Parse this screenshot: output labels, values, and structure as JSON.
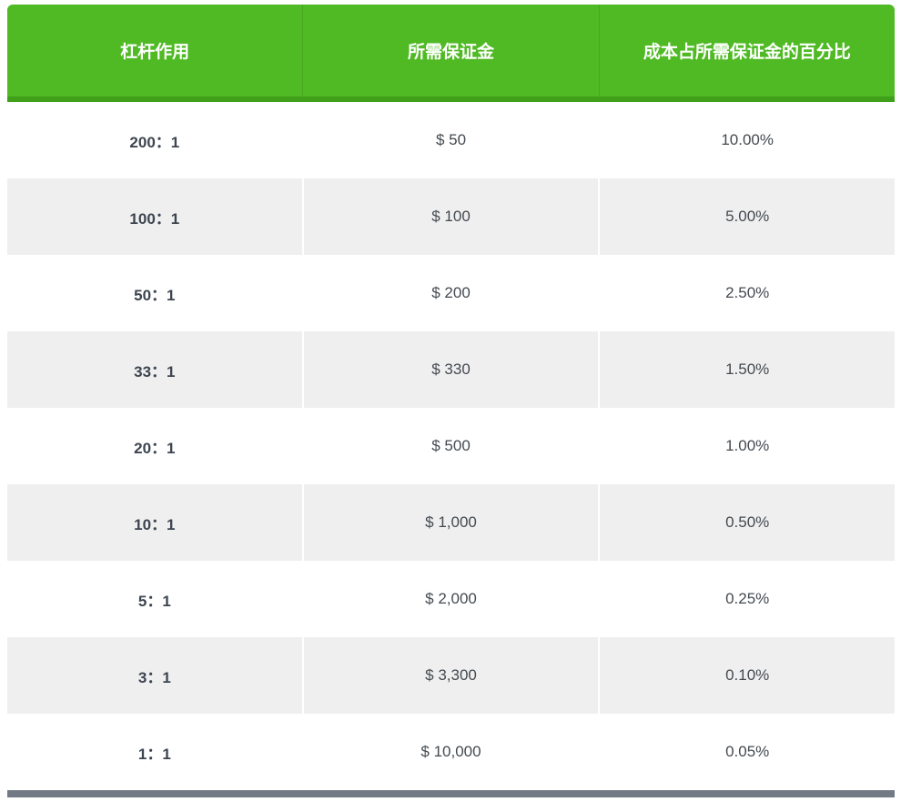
{
  "table": {
    "headers": [
      "杠杆作用",
      "所需保证金",
      "成本占所需保证金的百分比"
    ],
    "rows": [
      [
        "200：1",
        "$ 50",
        "10.00%"
      ],
      [
        "100：1",
        "$ 100",
        "5.00%"
      ],
      [
        "50：1",
        "$ 200",
        "2.50%"
      ],
      [
        "33：1",
        "$ 330",
        "1.50%"
      ],
      [
        "20：1",
        "$ 500",
        "1.00%"
      ],
      [
        "10：1",
        "$ 1,000",
        "0.50%"
      ],
      [
        "5：1",
        "$ 2,000",
        "0.25%"
      ],
      [
        "3：1",
        "$ 3,300",
        "0.10%"
      ],
      [
        "1：1",
        "$ 10,000",
        "0.05%"
      ]
    ]
  },
  "colors": {
    "header_bg": "#4fba24",
    "header_border": "#40a01a",
    "row_alt_bg": "#efefef",
    "footer_bar": "#737a86"
  }
}
